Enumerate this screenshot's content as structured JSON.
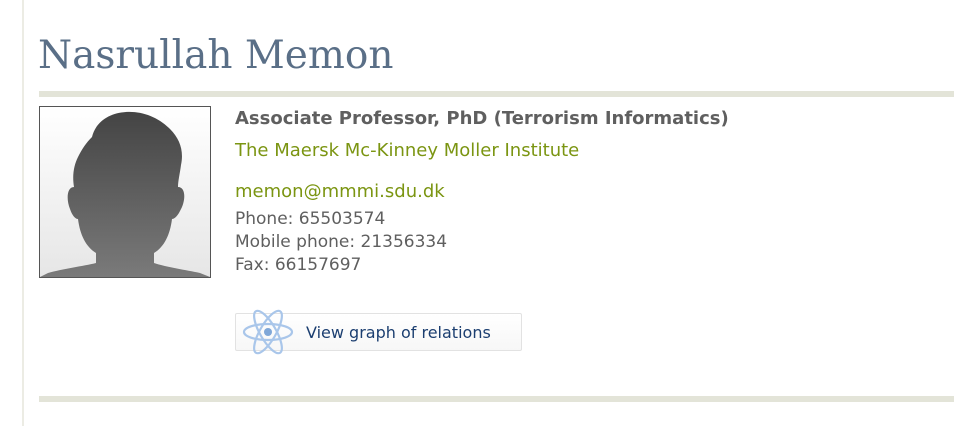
{
  "person": {
    "name": "Nasrullah Memon",
    "title": "Associate Professor, PhD (Terrorism Informatics)",
    "organization": "The Maersk Mc-Kinney Moller Institute",
    "email": "memon@mmmi.sdu.dk",
    "phone": "Phone: 65503574",
    "mobile": "Mobile phone: 21356334",
    "fax": "Fax: 66157697"
  },
  "actions": {
    "graph_label": "View graph of relations"
  },
  "colors": {
    "name": "#5a6f87",
    "link_green": "#7b9512",
    "text_gray": "#5f5f5f",
    "button_text": "#1b3e70",
    "rule": "#e3e4d8"
  },
  "icons": {
    "portrait": "person-silhouette",
    "graph": "atom-icon"
  }
}
